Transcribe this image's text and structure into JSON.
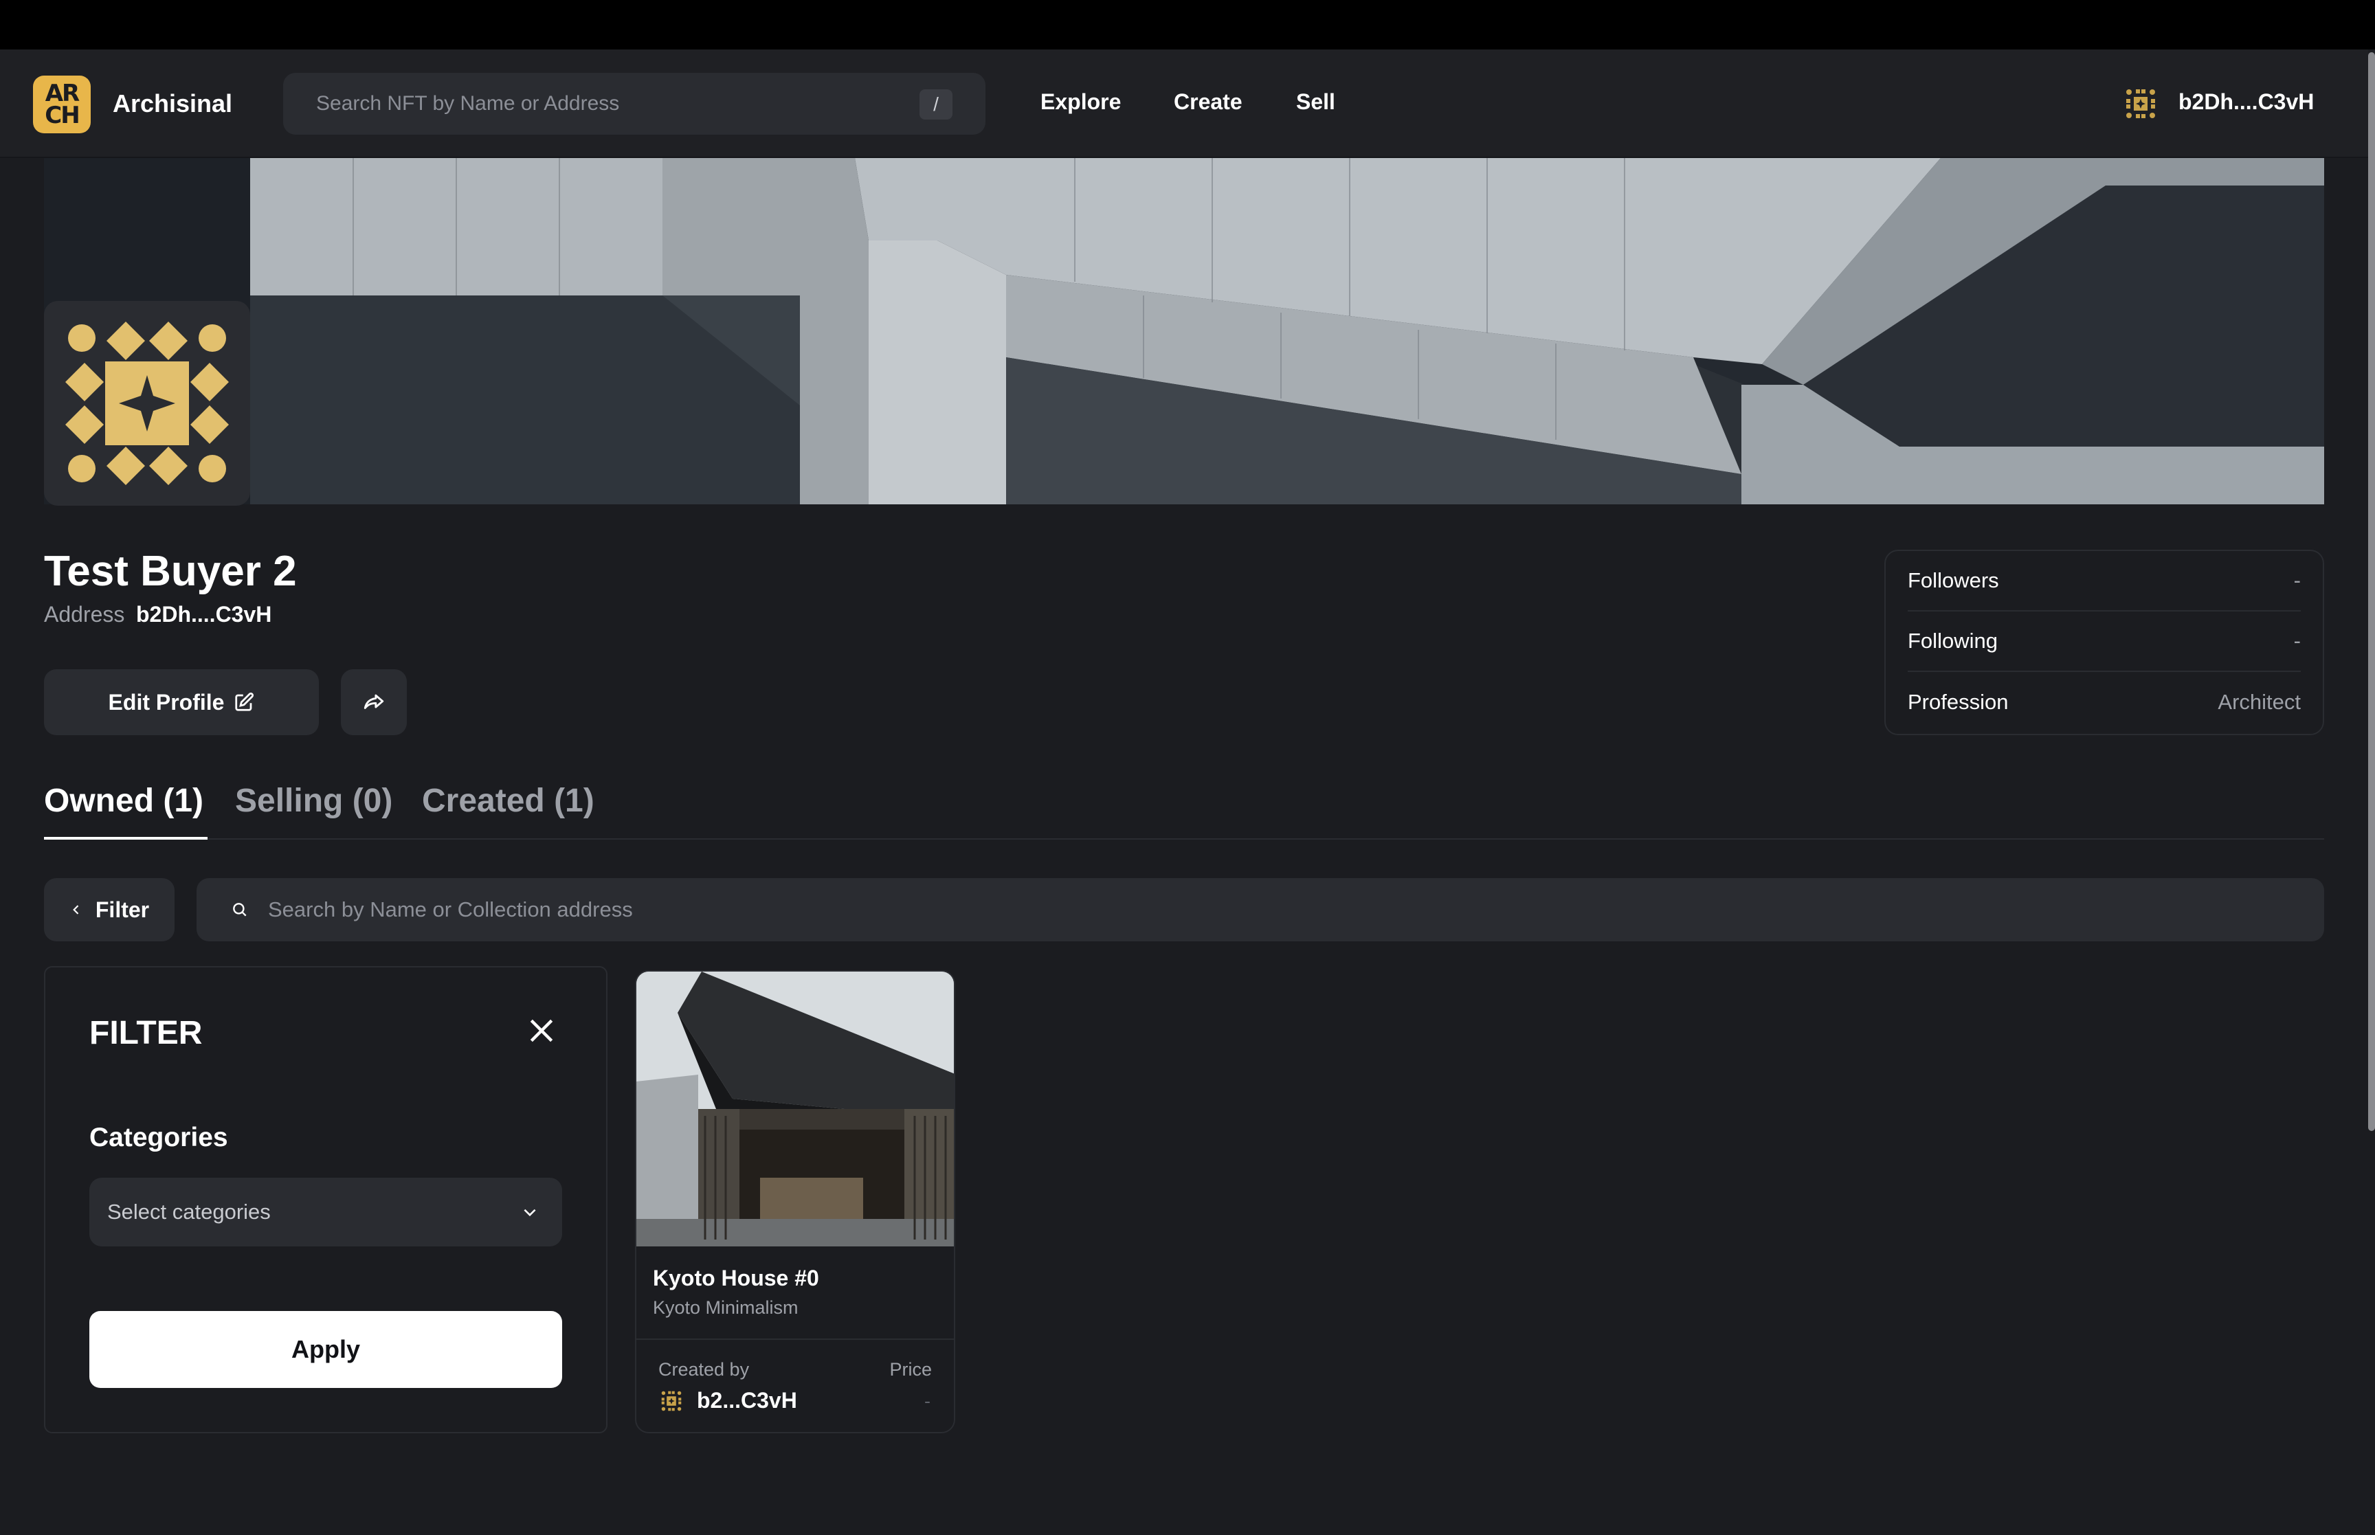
{
  "colors": {
    "accent": "#e8b64a",
    "background": "#1b1c20",
    "surface": "#2a2c31",
    "apply_button": "#ffffff"
  },
  "nav": {
    "logo_text": "AR\nCH",
    "brand": "Archisinal",
    "search_placeholder": "Search NFT by Name or Address",
    "search_shortcut": "/",
    "links": [
      "Explore",
      "Create",
      "Sell"
    ],
    "user": "b2Dh....C3vH"
  },
  "profile": {
    "name": "Test Buyer 2",
    "address_label": "Address",
    "address_value": "b2Dh....C3vH",
    "edit_label": "Edit Profile",
    "stats": [
      {
        "label": "Followers",
        "value": "-"
      },
      {
        "label": "Following",
        "value": "-"
      },
      {
        "label": "Profession",
        "value": "Architect"
      }
    ]
  },
  "tabs": [
    {
      "label": "Owned (1)",
      "active": true
    },
    {
      "label": "Selling (0)",
      "active": false
    },
    {
      "label": "Created (1)",
      "active": false
    }
  ],
  "toolbar": {
    "filter_label": "Filter",
    "search_placeholder": "Search by Name or Collection address"
  },
  "filter_panel": {
    "title": "FILTER",
    "categories_label": "Categories",
    "select_placeholder": "Select categories",
    "apply_label": "Apply"
  },
  "cards": [
    {
      "title": "Kyoto House #0",
      "collection": "Kyoto Minimalism",
      "created_by_label": "Created by",
      "creator": "b2...C3vH",
      "price_label": "Price",
      "price": "-"
    }
  ]
}
